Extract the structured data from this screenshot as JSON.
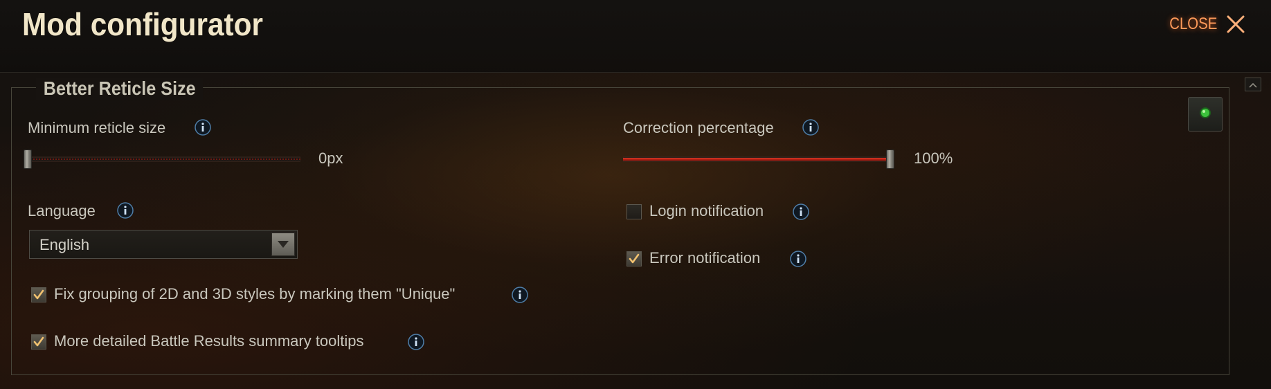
{
  "header": {
    "title": "Mod configurator",
    "close_label": "CLOSE"
  },
  "section": {
    "title": "Better Reticle Size"
  },
  "settings": {
    "min_reticle_size": {
      "label": "Minimum reticle size",
      "value_text": "0px",
      "level": 0
    },
    "correction_percentage": {
      "label": "Correction percentage",
      "value_text": "100%",
      "level": 1
    },
    "language": {
      "label": "Language",
      "selected": "English"
    },
    "login_notification": {
      "label": "Login notification",
      "checked": false
    },
    "error_notification": {
      "label": "Error notification",
      "checked": true
    },
    "fix_grouping": {
      "label": "Fix grouping of 2D and 3D styles by marking them \"Unique\"",
      "checked": true
    },
    "detailed_tooltips": {
      "label": "More detailed Battle Results summary tooltips",
      "checked": true
    }
  },
  "colors": {
    "accent_close": "#ff9b5a",
    "slider_fill": "#b01c10",
    "info_icon": "#6ea3d8",
    "status_led": "#3cc23c"
  },
  "icons": {
    "close": "close-icon",
    "info": "info-icon",
    "dropdown": "chevron-down-icon",
    "check": "check-icon",
    "status": "status-led-icon",
    "scroll": "scroll-up-icon"
  }
}
